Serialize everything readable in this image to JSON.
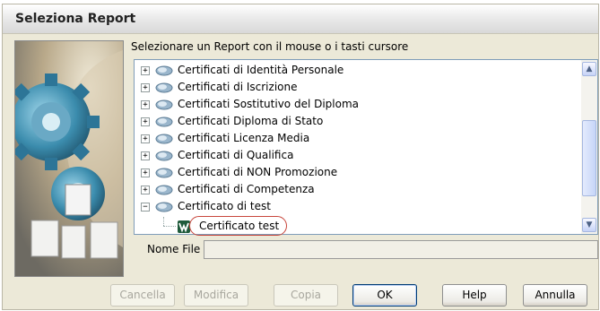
{
  "window": {
    "title": "Seleziona Report"
  },
  "instruction": "Selezionare un Report con il mouse o i tasti cursore",
  "tree": {
    "items": [
      {
        "label": "Certificati di Identità Personale",
        "expander": "+"
      },
      {
        "label": "Certificati di Iscrizione",
        "expander": "+"
      },
      {
        "label": "Certificati Sostitutivo del Diploma",
        "expander": "+"
      },
      {
        "label": "Certificati Diploma di Stato",
        "expander": "+"
      },
      {
        "label": "Certificati Licenza Media",
        "expander": "+"
      },
      {
        "label": "Certificati di Qualifica",
        "expander": "+"
      },
      {
        "label": "Certificati di NON Promozione",
        "expander": "+"
      },
      {
        "label": "Certificati di Competenza",
        "expander": "+"
      },
      {
        "label": "Certificato di test",
        "expander": "−"
      }
    ],
    "child": {
      "label": "Certificato test",
      "highlight_color": "#c8463c"
    }
  },
  "filename": {
    "label": "Nome File",
    "value": ""
  },
  "buttons": {
    "cancella": "Cancella",
    "modifica": "Modifica",
    "copia": "Copia",
    "ok": "OK",
    "help": "Help",
    "annulla": "Annulla"
  },
  "colors": {
    "window_bg": "#ece9d8",
    "accent": "#003c74"
  }
}
